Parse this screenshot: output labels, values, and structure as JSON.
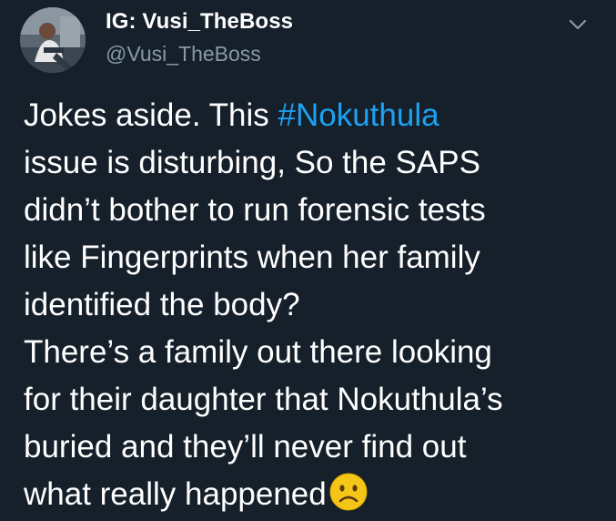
{
  "header": {
    "display_name": "IG: Vusi_TheBoss",
    "handle": "@Vusi_TheBoss",
    "avatar_icon": "profile-photo",
    "more_icon": "chevron-down-icon"
  },
  "tweet": {
    "line1_prefix": "Jokes aside. This ",
    "hashtag": "#Nokuthula",
    "line2": " issue is disturbing, So the SAPS",
    "line3": "didn’t bother to run forensic tests",
    "line4": "like Fingerprints when her family",
    "line5": "identified the body?",
    "line6": "There’s a family out there looking",
    "line7": "for their daughter that Nokuthula’s",
    "line8": "buried and they’ll never find out",
    "line9": "what really happened",
    "emoji_icon": "sad-face-emoji"
  },
  "colors": {
    "background": "#15202b",
    "text": "#ffffff",
    "secondary": "#8899a6",
    "link": "#1da1f2",
    "emoji": "#f5c518"
  }
}
